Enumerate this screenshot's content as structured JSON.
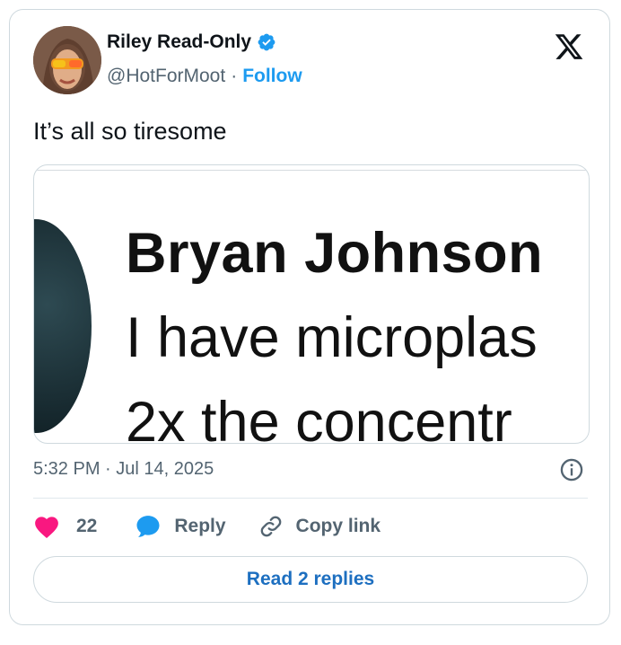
{
  "author": {
    "name": "Riley Read-Only",
    "handle": "@HotForMoot",
    "separator": "·",
    "follow_label": "Follow",
    "verified": true
  },
  "tweet": {
    "text": "It’s all so tiresome"
  },
  "media": {
    "line1": "Bryan Johnson",
    "line2": "I have microplas",
    "line3": "2x the concentr"
  },
  "meta": {
    "timestamp": "5:32 PM · Jul 14, 2025"
  },
  "actions": {
    "like_count": "22",
    "reply_label": "Reply",
    "copy_label": "Copy link"
  },
  "footer": {
    "read_replies_label": "Read 2 replies"
  },
  "colors": {
    "accent": "#1d9bf0",
    "like": "#f91880",
    "text": "#0f1419",
    "muted": "#536471"
  },
  "icons": [
    "x-logo-icon",
    "verified-badge-icon",
    "heart-icon",
    "reply-bubble-icon",
    "link-icon",
    "info-icon"
  ]
}
